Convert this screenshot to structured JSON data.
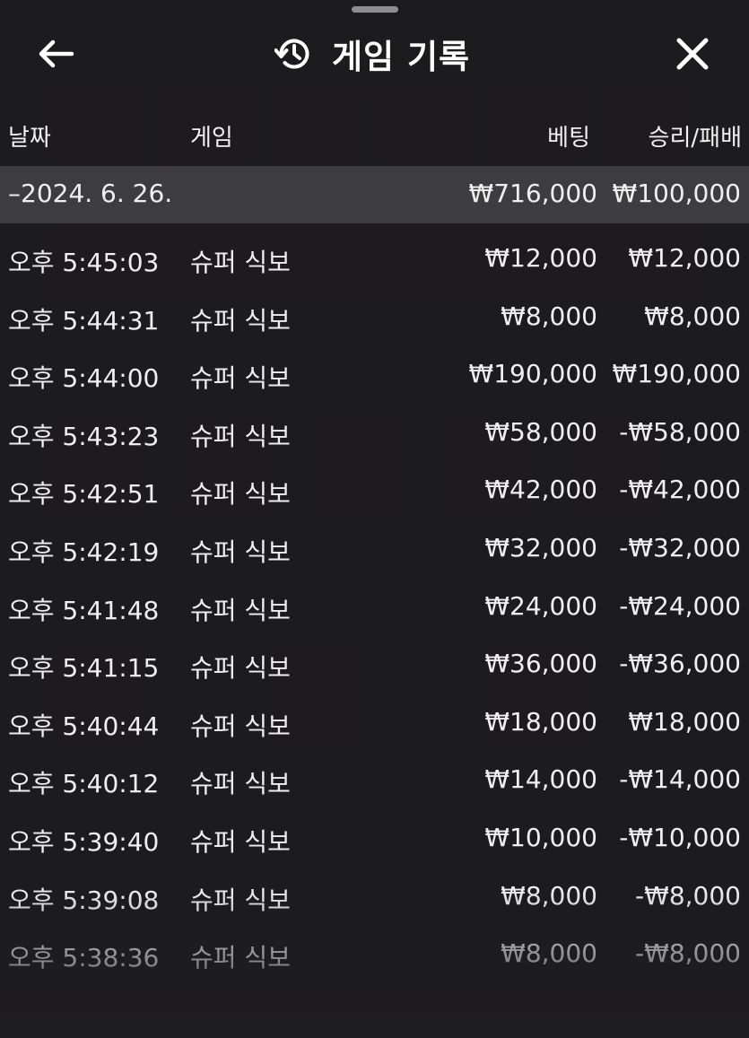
{
  "header": {
    "title": "게임 기록"
  },
  "columns": {
    "date": "날짜",
    "game": "게임",
    "bet": "베팅",
    "result": "승리/패배"
  },
  "date_group": {
    "label": "–2024. 6. 26.",
    "bet": "₩716,000",
    "result": "₩100,000"
  },
  "rows": [
    {
      "time": "오후 5:45:03",
      "game": "슈퍼 식보",
      "bet": "₩12,000",
      "result": "₩12,000"
    },
    {
      "time": "오후 5:44:31",
      "game": "슈퍼 식보",
      "bet": "₩8,000",
      "result": "₩8,000"
    },
    {
      "time": "오후 5:44:00",
      "game": "슈퍼 식보",
      "bet": "₩190,000",
      "result": "₩190,000"
    },
    {
      "time": "오후 5:43:23",
      "game": "슈퍼 식보",
      "bet": "₩58,000",
      "result": "-₩58,000"
    },
    {
      "time": "오후 5:42:51",
      "game": "슈퍼 식보",
      "bet": "₩42,000",
      "result": "-₩42,000"
    },
    {
      "time": "오후 5:42:19",
      "game": "슈퍼 식보",
      "bet": "₩32,000",
      "result": "-₩32,000"
    },
    {
      "time": "오후 5:41:48",
      "game": "슈퍼 식보",
      "bet": "₩24,000",
      "result": "-₩24,000"
    },
    {
      "time": "오후 5:41:15",
      "game": "슈퍼 식보",
      "bet": "₩36,000",
      "result": "-₩36,000"
    },
    {
      "time": "오후 5:40:44",
      "game": "슈퍼 식보",
      "bet": "₩18,000",
      "result": "₩18,000"
    },
    {
      "time": "오후 5:40:12",
      "game": "슈퍼 식보",
      "bet": "₩14,000",
      "result": "-₩14,000"
    },
    {
      "time": "오후 5:39:40",
      "game": "슈퍼 식보",
      "bet": "₩10,000",
      "result": "-₩10,000"
    },
    {
      "time": "오후 5:39:08",
      "game": "슈퍼 식보",
      "bet": "₩8,000",
      "result": "-₩8,000"
    },
    {
      "time": "오후 5:38:36",
      "game": "슈퍼 식보",
      "bet": "₩8,000",
      "result": "-₩8,000"
    }
  ],
  "icons": {
    "back": "arrow-left-icon",
    "history": "history-icon",
    "close": "close-icon"
  },
  "colors": {
    "background": "#1e1d1f",
    "date_row": "#3d3c3f",
    "text": "#efefef"
  }
}
